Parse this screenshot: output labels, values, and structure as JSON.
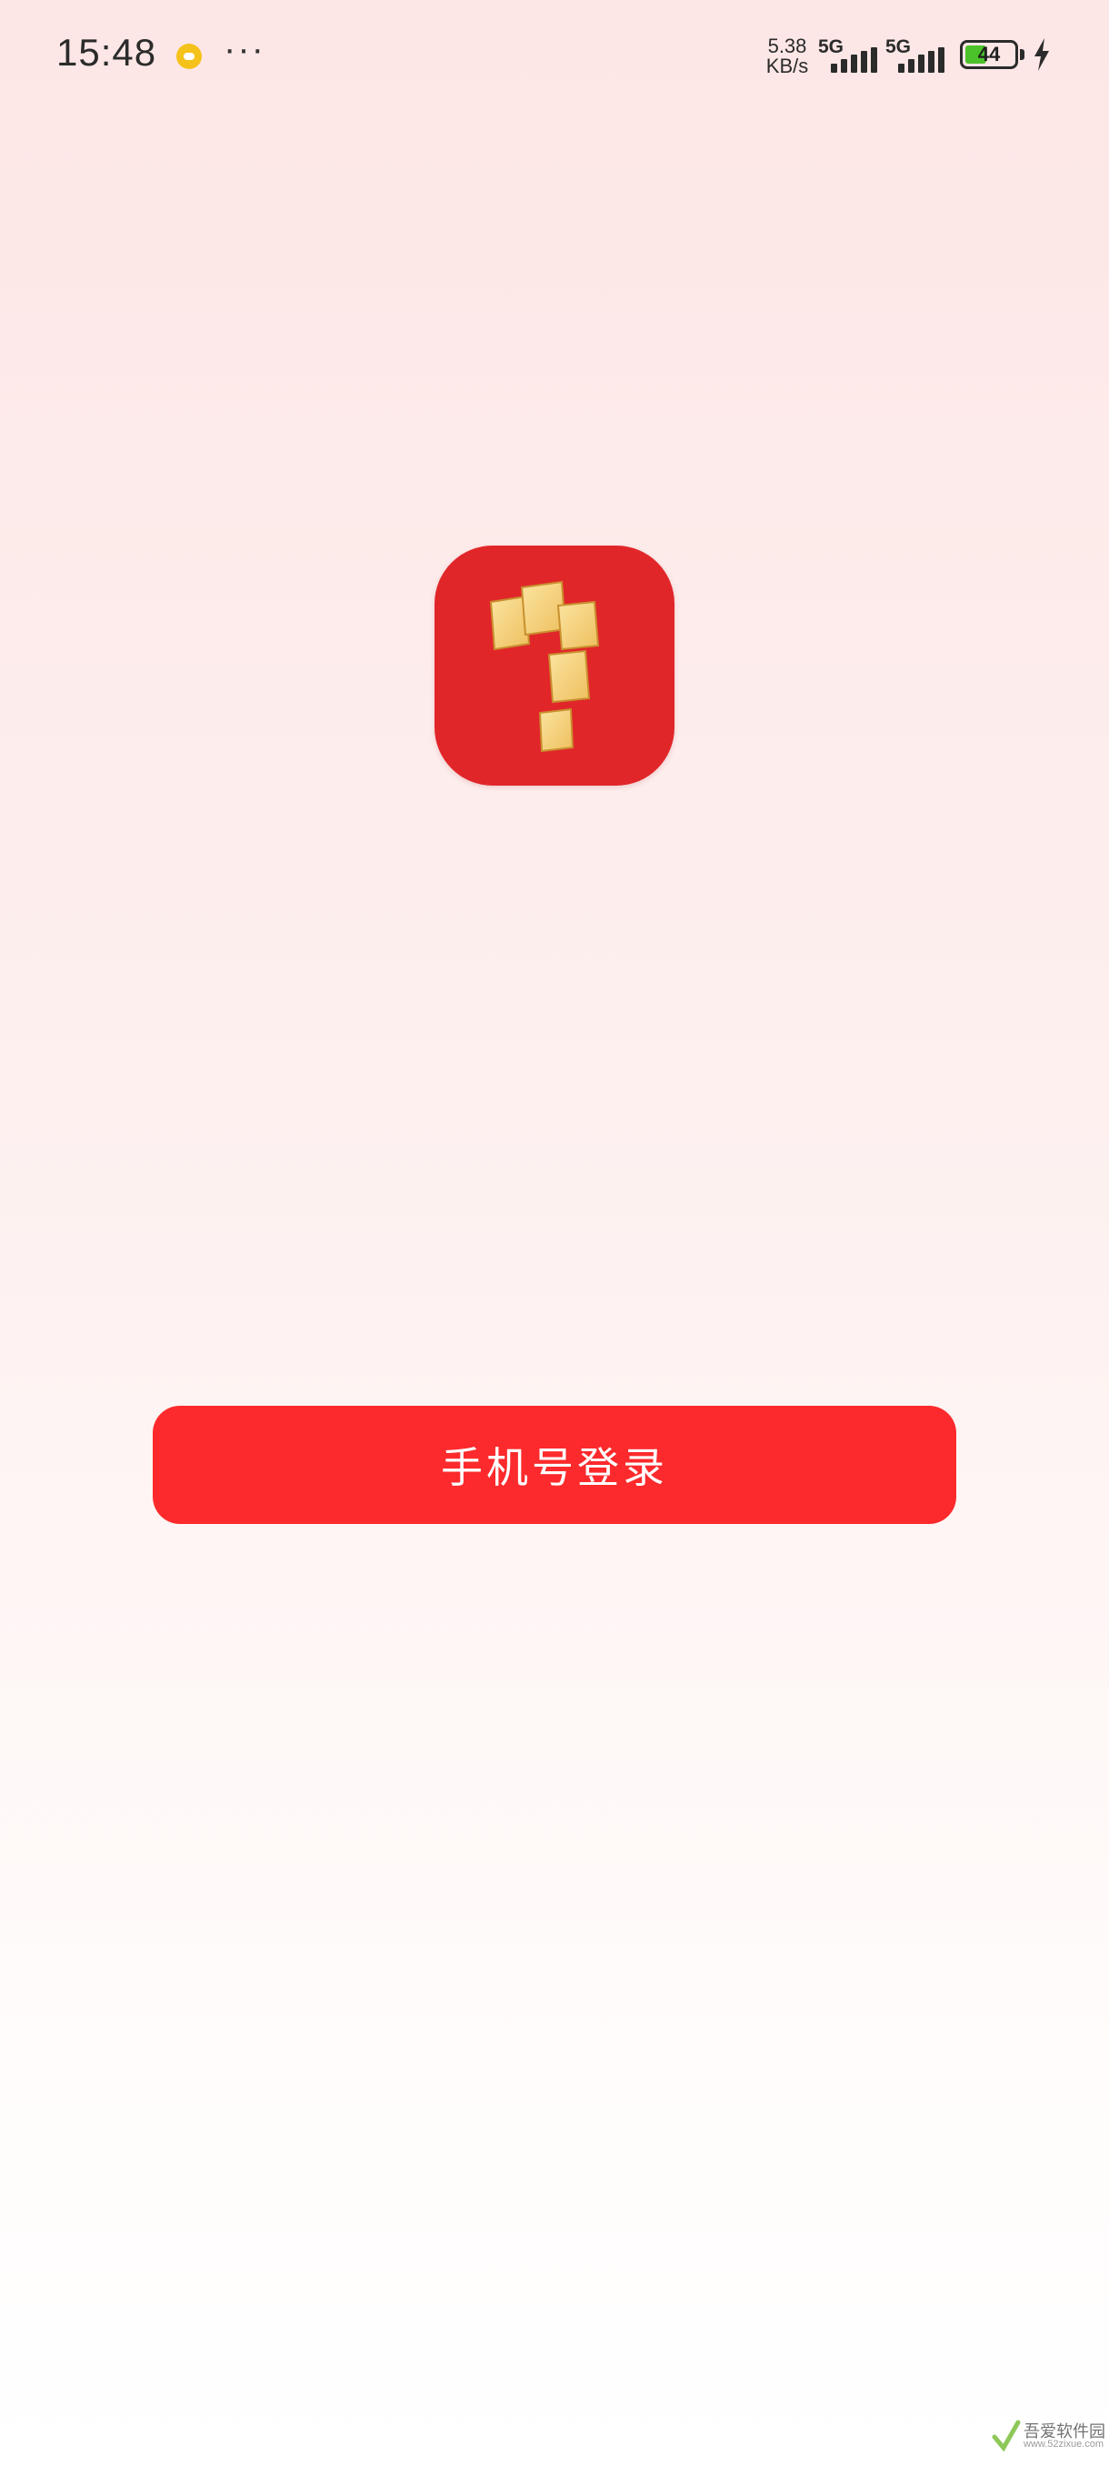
{
  "status_bar": {
    "time": "15:48",
    "more": "···",
    "net_speed_value": "5.38",
    "net_speed_unit": "KB/s",
    "signal_1_label": "5G",
    "signal_2_label": "5G",
    "battery_level": "44",
    "battery_fraction": 0.44,
    "icons": [
      "notification-bubble-icon",
      "signal-icon",
      "battery-icon",
      "charging-bolt-icon"
    ]
  },
  "app": {
    "logo_icon": "app-logo-icon",
    "logo_color": "#e1262a",
    "logo_tile_color": "#f5d27c"
  },
  "login": {
    "phone_login_label": "手机号登录",
    "button_color": "#fc2a2c"
  },
  "watermark": {
    "text": "吾爱软件园",
    "sub": "www.52zixue.com"
  }
}
